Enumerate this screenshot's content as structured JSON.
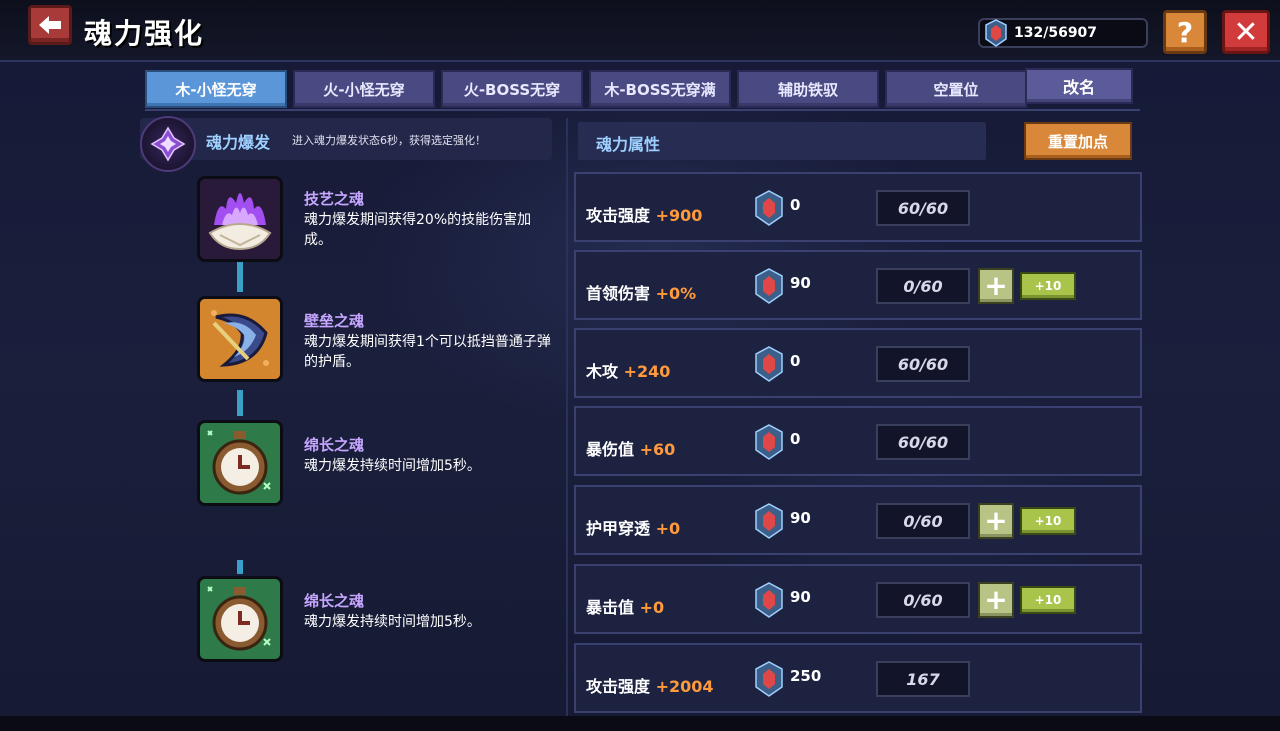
{
  "header": {
    "title": "魂力强化",
    "currency": "132/56907"
  },
  "tabs": [
    {
      "label": "木-小怪无穿",
      "active": true
    },
    {
      "label": "火-小怪无穿",
      "active": false
    },
    {
      "label": "火-BOSS无穿",
      "active": false
    },
    {
      "label": "木-BOSS无穿满",
      "active": false
    },
    {
      "label": "辅助铁驭",
      "active": false
    },
    {
      "label": "空置位",
      "active": false
    }
  ],
  "rename_label": "改名",
  "burst": {
    "title": "魂力爆发",
    "desc": "进入魂力爆发状态6秒，获得选定强化！"
  },
  "attr_header": "魂力属性",
  "reset_label": "重置加点",
  "souls": [
    {
      "name": "技艺之魂",
      "desc": "魂力爆发期间获得20%的技能伤害加成。",
      "icon": "purple-flame-shell-icon"
    },
    {
      "name": "壁垒之魂",
      "desc": "魂力爆发期间获得1个可以抵挡普通子弹的护盾。",
      "icon": "shield-icon"
    },
    {
      "name": "绵长之魂",
      "desc": "魂力爆发持续时间增加5秒。",
      "icon": "stopwatch-icon"
    },
    {
      "name": "绵长之魂",
      "desc": "魂力爆发持续时间增加5秒。",
      "icon": "stopwatch-icon"
    }
  ],
  "attributes": [
    {
      "name": "攻击强度",
      "bonus": "+900",
      "cost": "0",
      "level": "60/60",
      "upgradable": false
    },
    {
      "name": "首领伤害",
      "bonus": "+0%",
      "cost": "90",
      "level": "0/60",
      "upgradable": true
    },
    {
      "name": "木攻",
      "bonus": "+240",
      "cost": "0",
      "level": "60/60",
      "upgradable": false
    },
    {
      "name": "暴伤值",
      "bonus": "+60",
      "cost": "0",
      "level": "60/60",
      "upgradable": false
    },
    {
      "name": "护甲穿透",
      "bonus": "+0",
      "cost": "90",
      "level": "0/60",
      "upgradable": true
    },
    {
      "name": "暴击值",
      "bonus": "+0",
      "cost": "90",
      "level": "0/60",
      "upgradable": true
    },
    {
      "name": "攻击强度",
      "bonus": "+2004",
      "cost": "250",
      "level": "167",
      "upgradable": false
    }
  ],
  "buttons": {
    "plus": "+",
    "plus10": "+10",
    "help": "?",
    "close": "✕",
    "back": "🡄"
  },
  "colors": {
    "bonus": "#ff9a3c",
    "accent_blue": "#9ed0ff",
    "soul_name": "#c6a6ff"
  }
}
